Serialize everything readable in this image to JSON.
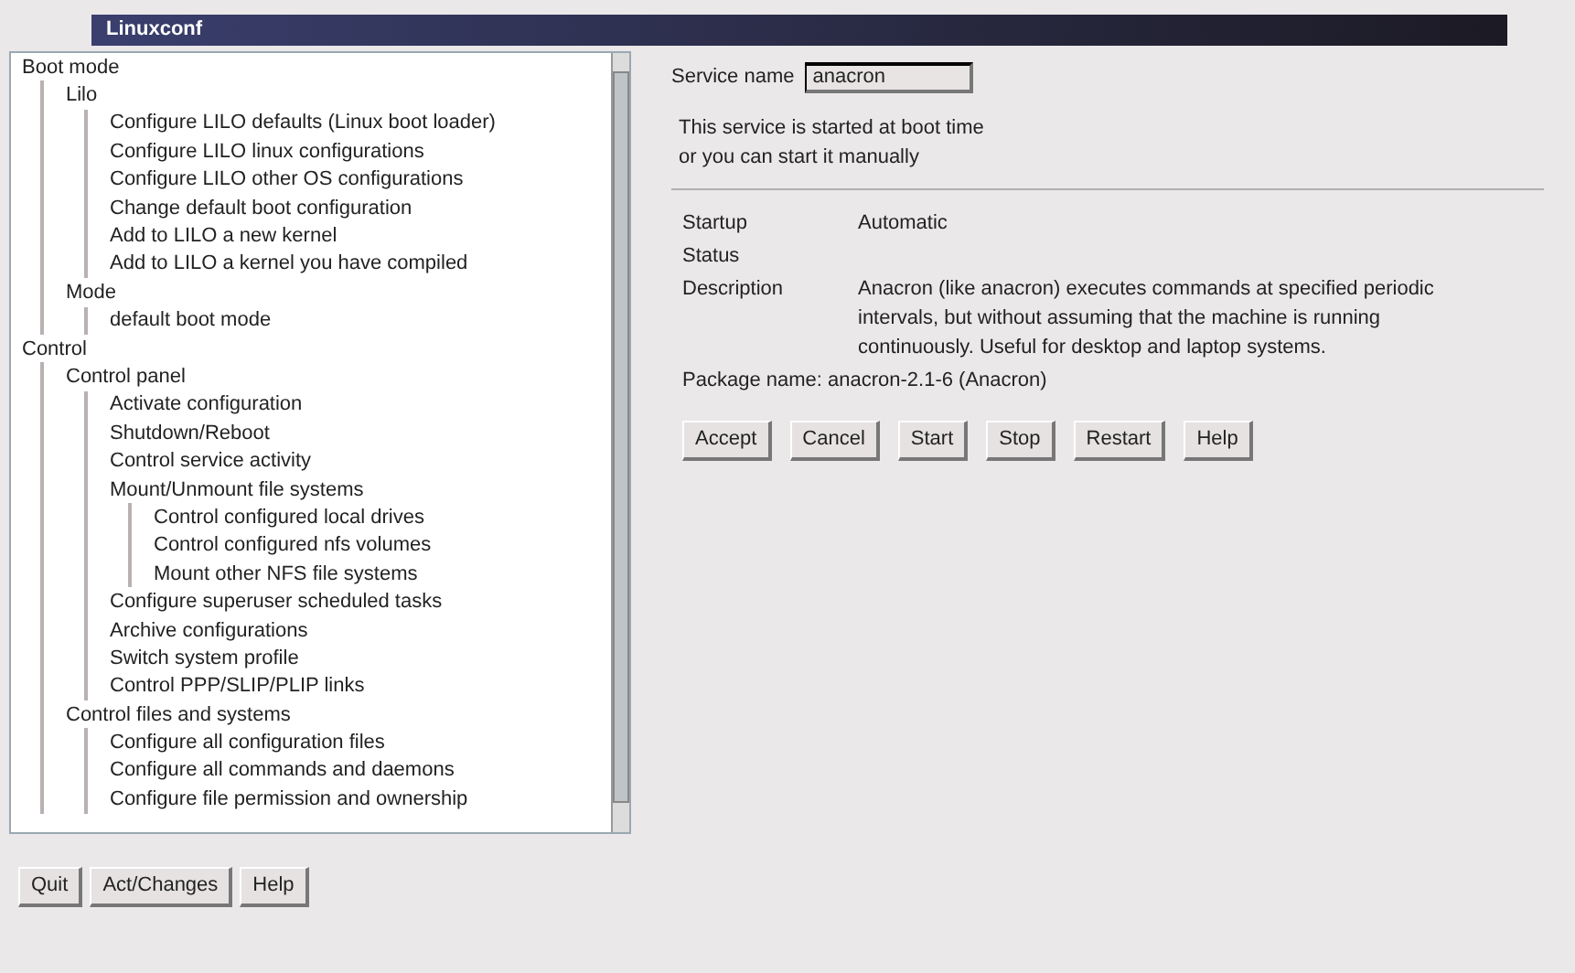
{
  "window": {
    "title": "Linuxconf"
  },
  "tree": [
    {
      "label": "Boot mode",
      "children": [
        {
          "label": "Lilo",
          "children": [
            {
              "label": "Configure LILO defaults (Linux boot loader)"
            },
            {
              "label": "Configure LILO linux configurations"
            },
            {
              "label": "Configure LILO other OS configurations"
            },
            {
              "label": "Change default boot configuration"
            },
            {
              "label": "Add to LILO a new kernel"
            },
            {
              "label": "Add to LILO a kernel you have compiled"
            }
          ]
        },
        {
          "label": "Mode",
          "children": [
            {
              "label": "default boot mode"
            }
          ]
        }
      ]
    },
    {
      "label": "Control",
      "children": [
        {
          "label": "Control panel",
          "children": [
            {
              "label": "Activate configuration"
            },
            {
              "label": "Shutdown/Reboot"
            },
            {
              "label": "Control service activity"
            },
            {
              "label": "Mount/Unmount file systems",
              "children": [
                {
                  "label": "Control configured local drives"
                },
                {
                  "label": "Control configured nfs volumes"
                },
                {
                  "label": "Mount other NFS file systems"
                }
              ]
            },
            {
              "label": "Configure superuser scheduled tasks"
            },
            {
              "label": "Archive configurations"
            },
            {
              "label": "Switch system profile"
            },
            {
              "label": "Control PPP/SLIP/PLIP links"
            }
          ]
        },
        {
          "label": "Control files and systems",
          "children": [
            {
              "label": "Configure all configuration files"
            },
            {
              "label": "Configure all commands and daemons"
            },
            {
              "label": "Configure file permission and ownership"
            }
          ]
        }
      ]
    }
  ],
  "form": {
    "name_label": "Service name",
    "name_value": "anacron",
    "intro": [
      "This service is started at boot time",
      "or you can start it manually"
    ],
    "fields": [
      {
        "label": "Startup",
        "value": "Automatic"
      },
      {
        "label": "Status"
      },
      {
        "label": "Description",
        "value": "Anacron (like anacron) executes commands at specified periodic intervals, but without assuming that the machine is running continuously. Useful for desktop and laptop systems."
      }
    ],
    "package": "Package name: anacron-2.1-6 (Anacron)",
    "buttons": [
      "Accept",
      "Cancel",
      "Start",
      "Stop",
      "Restart",
      "Help"
    ]
  },
  "bottom_buttons": [
    "Quit",
    "Act/Changes",
    "Help"
  ]
}
